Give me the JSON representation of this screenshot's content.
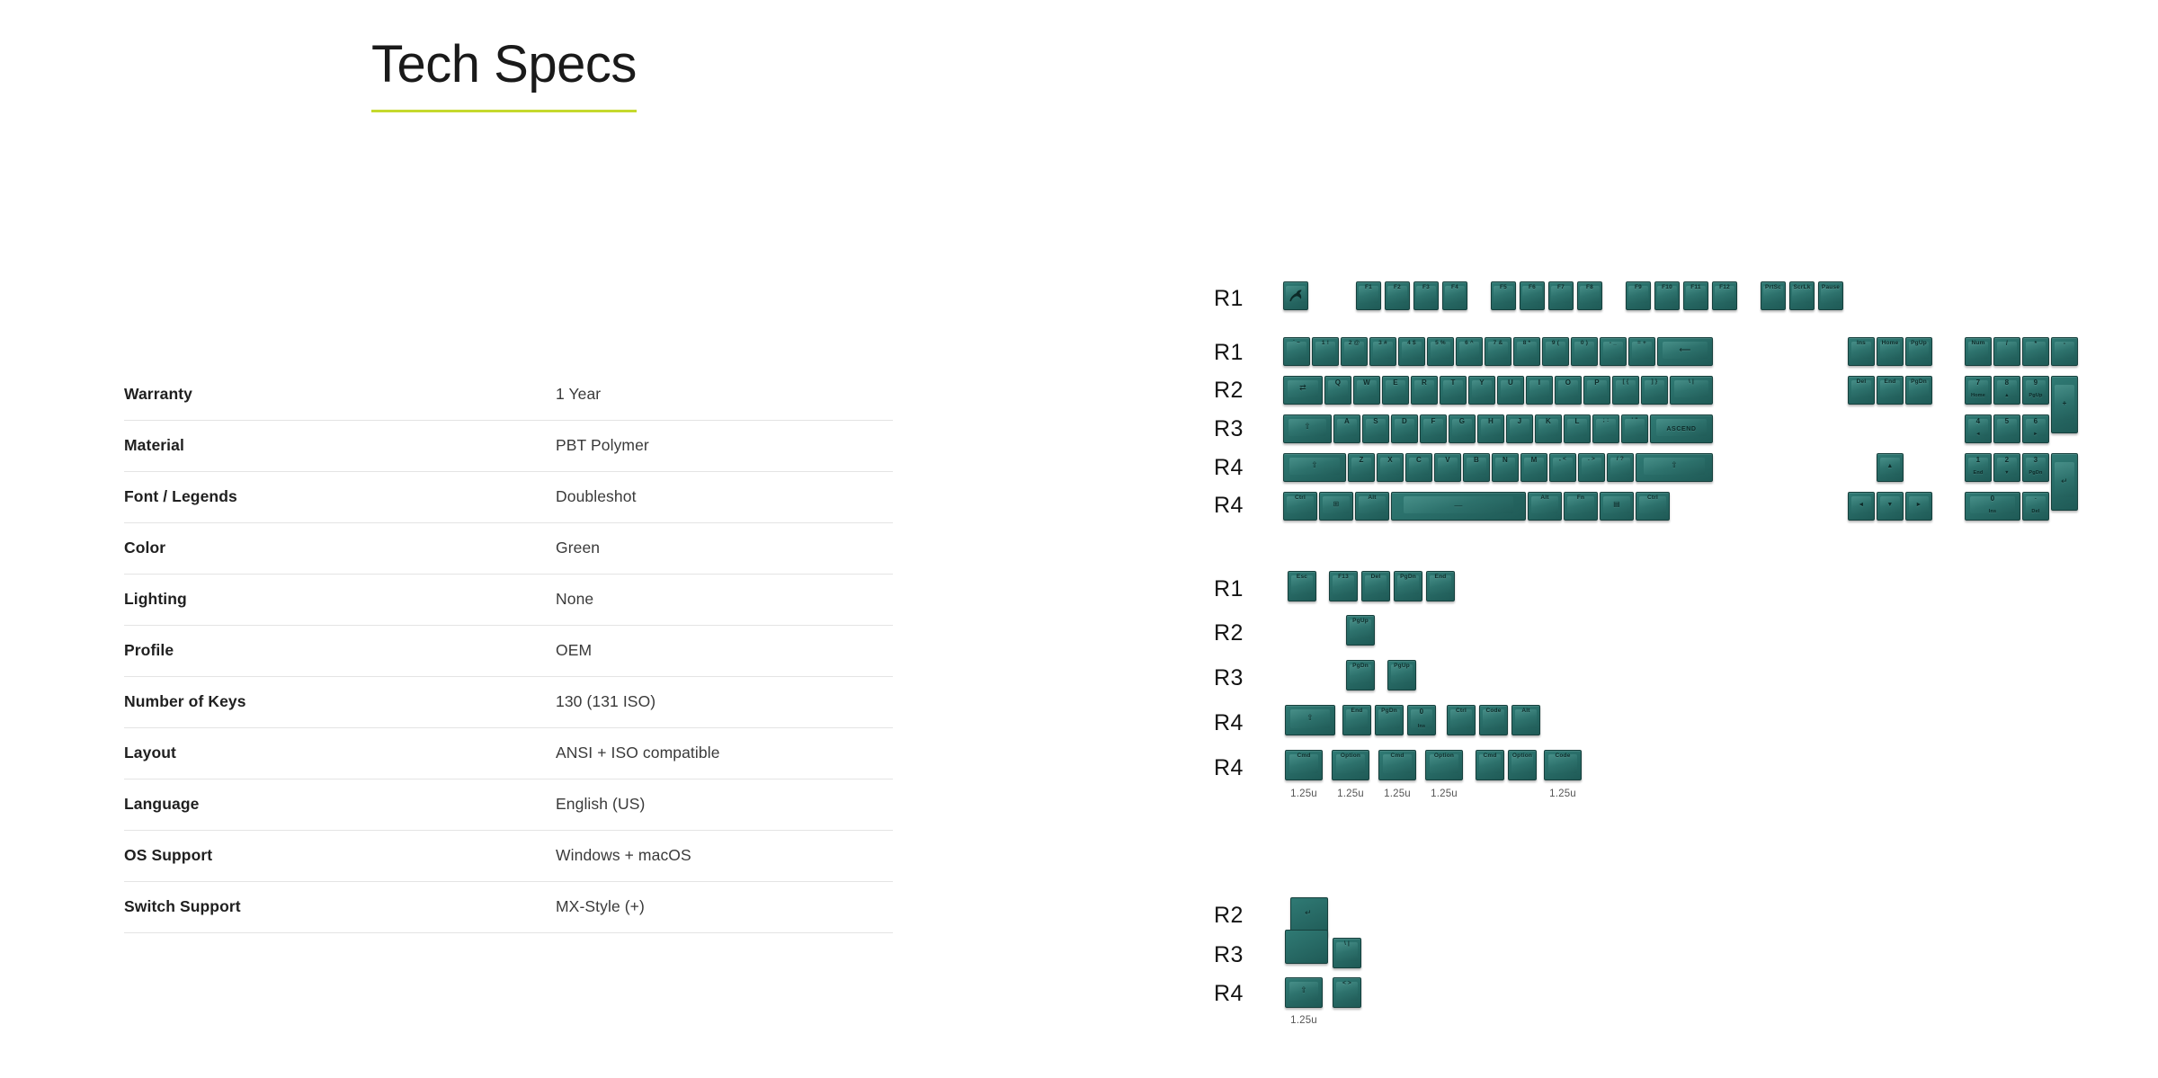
{
  "header": {
    "title": "Tech Specs",
    "underline_color": "#c5d92d"
  },
  "specs": {
    "rows": [
      {
        "label": "Warranty",
        "value": "1 Year"
      },
      {
        "label": "Material",
        "value": "PBT Polymer"
      },
      {
        "label": "Font / Legends",
        "value": "Doubleshot"
      },
      {
        "label": "Color",
        "value": "Green"
      },
      {
        "label": "Lighting",
        "value": "None"
      },
      {
        "label": "Profile",
        "value": "OEM"
      },
      {
        "label": "Number of Keys",
        "value": "130 (131 ISO)"
      },
      {
        "label": "Layout",
        "value": "ANSI + ISO compatible"
      },
      {
        "label": "Language",
        "value": "English (US)"
      },
      {
        "label": "OS Support",
        "value": "Windows + macOS"
      },
      {
        "label": "Switch Support",
        "value": "MX-Style (+)"
      }
    ]
  },
  "keycap_kit": {
    "keycap_color": "#2a6f6a",
    "legend_color": "#0c2a28",
    "groups": [
      {
        "name": "main-keyboard",
        "row_labels": [
          "R1",
          "R1",
          "R2",
          "R3",
          "R4",
          "R4"
        ],
        "rows": [
          {
            "label": "R1",
            "keys": [
              "Esc-logo",
              "F1",
              "F2",
              "F3",
              "F4",
              "F5",
              "F6",
              "F7",
              "F8",
              "F9",
              "F10",
              "F11",
              "F12",
              "PrtSc",
              "ScrLk",
              "Pause"
            ]
          },
          {
            "label": "R1",
            "keys": [
              "` ~",
              "1 !",
              "2 @",
              "3 #",
              "4 $",
              "5 %",
              "6 ^",
              "7 &",
              "8 *",
              "9 (",
              "0 )",
              "- _",
              "= +",
              "Backspace",
              "Ins",
              "Home",
              "PgUp",
              "Num",
              "/",
              "*",
              "-"
            ]
          },
          {
            "label": "R2",
            "keys": [
              "Tab",
              "Q",
              "W",
              "E",
              "R",
              "T",
              "Y",
              "U",
              "I",
              "O",
              "P",
              "[ {",
              "] }",
              "\\ |",
              "Del",
              "End",
              "PgDn",
              "7 Home",
              "8 ▲",
              "9 PgUp",
              "+"
            ]
          },
          {
            "label": "R3",
            "keys": [
              "Caps Lock",
              "A",
              "S",
              "D",
              "F",
              "G",
              "H",
              "J",
              "K",
              "L",
              "; :",
              "' \"",
              "ASCEND",
              "4 ◄",
              "5",
              "6 ►"
            ]
          },
          {
            "label": "R4",
            "keys": [
              "Shift",
              "Z",
              "X",
              "C",
              "V",
              "B",
              "N",
              "M",
              ", <",
              ". >",
              "/ ?",
              "Shift",
              "▲",
              "1 End",
              "2 ▼",
              "3 PgDn",
              "Enter"
            ]
          },
          {
            "label": "R4",
            "keys": [
              "Ctrl",
              "Win",
              "Alt",
              "Space",
              "Alt",
              "Fn",
              "Menu",
              "Ctrl",
              "◄",
              "▼",
              "►",
              "0 Ins",
              ". Del"
            ]
          }
        ]
      },
      {
        "name": "extras-kit",
        "row_labels": [
          "R1",
          "R2",
          "R3",
          "R4",
          "R4"
        ],
        "rows": [
          {
            "label": "R1",
            "keys": [
              "Esc",
              "F13",
              "Del",
              "PgDn",
              "End"
            ]
          },
          {
            "label": "R2",
            "keys": [
              "PgUp"
            ]
          },
          {
            "label": "R3",
            "keys": [
              "PgDn",
              "PgUp"
            ]
          },
          {
            "label": "R4",
            "keys": [
              "Shift",
              "End",
              "PgDn",
              "0 Ins",
              "Ctrl",
              "Code",
              "Alt"
            ]
          },
          {
            "label": "R4",
            "keys": [
              "Cmd",
              "Option",
              "Cmd",
              "Option",
              "Cmd",
              "Option",
              "Code"
            ]
          }
        ],
        "size_labels": [
          "1.25u",
          "1.25u",
          "1.25u",
          "1.25u",
          "1.25u"
        ]
      },
      {
        "name": "iso-kit",
        "row_labels": [
          "R2",
          "R3",
          "R4"
        ],
        "rows": [
          {
            "label": "R2",
            "keys": [
              "ISO Enter"
            ]
          },
          {
            "label": "R3",
            "keys": [
              "\\ |"
            ]
          },
          {
            "label": "R4",
            "keys": [
              "Shift",
              "< >"
            ]
          }
        ],
        "size_labels": [
          "1.25u"
        ]
      }
    ]
  }
}
